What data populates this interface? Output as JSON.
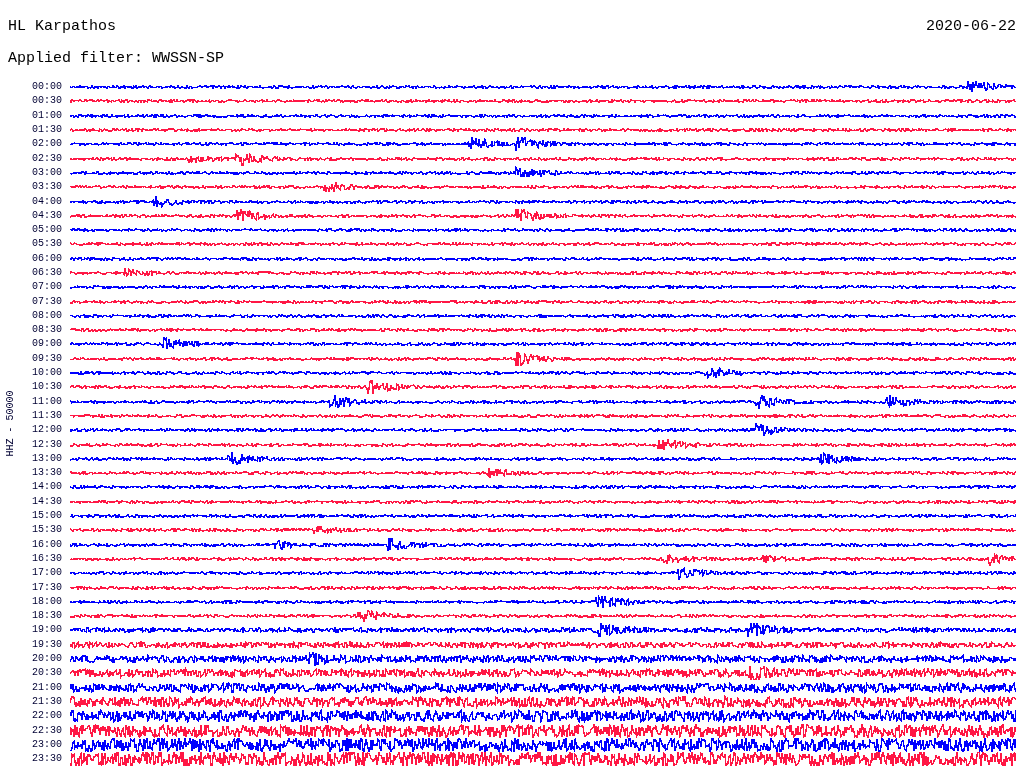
{
  "header": {
    "station": "HL Karpathos",
    "date": "2020-06-22",
    "filter": "Applied filter: WWSSN-SP"
  },
  "axis_label": "HHZ - 50000",
  "rows": [
    {
      "time": "00:00",
      "color": "#0000ff"
    },
    {
      "time": "00:30",
      "color": "#ff1744"
    },
    {
      "time": "01:00",
      "color": "#0000ff"
    },
    {
      "time": "01:30",
      "color": "#ff1744"
    },
    {
      "time": "02:00",
      "color": "#0000ff"
    },
    {
      "time": "02:30",
      "color": "#ff1744"
    },
    {
      "time": "03:00",
      "color": "#0000ff"
    },
    {
      "time": "03:30",
      "color": "#ff1744"
    },
    {
      "time": "04:00",
      "color": "#0000ff"
    },
    {
      "time": "04:30",
      "color": "#ff1744"
    },
    {
      "time": "05:00",
      "color": "#0000ff"
    },
    {
      "time": "05:30",
      "color": "#ff1744"
    },
    {
      "time": "06:00",
      "color": "#0000ff"
    },
    {
      "time": "06:30",
      "color": "#ff1744"
    },
    {
      "time": "07:00",
      "color": "#0000ff"
    },
    {
      "time": "07:30",
      "color": "#ff1744"
    },
    {
      "time": "08:00",
      "color": "#0000ff"
    },
    {
      "time": "08:30",
      "color": "#ff1744"
    },
    {
      "time": "09:00",
      "color": "#0000ff"
    },
    {
      "time": "09:30",
      "color": "#ff1744"
    },
    {
      "time": "10:00",
      "color": "#0000ff"
    },
    {
      "time": "10:30",
      "color": "#ff1744"
    },
    {
      "time": "11:00",
      "color": "#0000ff"
    },
    {
      "time": "11:30",
      "color": "#ff1744"
    },
    {
      "time": "12:00",
      "color": "#0000ff"
    },
    {
      "time": "12:30",
      "color": "#ff1744"
    },
    {
      "time": "13:00",
      "color": "#0000ff"
    },
    {
      "time": "13:30",
      "color": "#ff1744"
    },
    {
      "time": "14:00",
      "color": "#0000ff"
    },
    {
      "time": "14:30",
      "color": "#ff1744"
    },
    {
      "time": "15:00",
      "color": "#0000ff"
    },
    {
      "time": "15:30",
      "color": "#ff1744"
    },
    {
      "time": "16:00",
      "color": "#0000ff"
    },
    {
      "time": "16:30",
      "color": "#ff1744"
    },
    {
      "time": "17:00",
      "color": "#0000ff"
    },
    {
      "time": "17:30",
      "color": "#ff1744"
    },
    {
      "time": "18:00",
      "color": "#0000ff"
    },
    {
      "time": "18:30",
      "color": "#ff1744"
    },
    {
      "time": "19:00",
      "color": "#0000ff"
    },
    {
      "time": "19:30",
      "color": "#ff1744"
    },
    {
      "time": "20:00",
      "color": "#0000ff"
    },
    {
      "time": "20:30",
      "color": "#ff1744"
    },
    {
      "time": "21:00",
      "color": "#0000ff"
    },
    {
      "time": "21:30",
      "color": "#ff1744"
    },
    {
      "time": "22:00",
      "color": "#0000ff"
    },
    {
      "time": "22:30",
      "color": "#ff1744"
    },
    {
      "time": "23:00",
      "color": "#0000ff"
    },
    {
      "time": "23:30",
      "color": "#ff1744"
    }
  ]
}
